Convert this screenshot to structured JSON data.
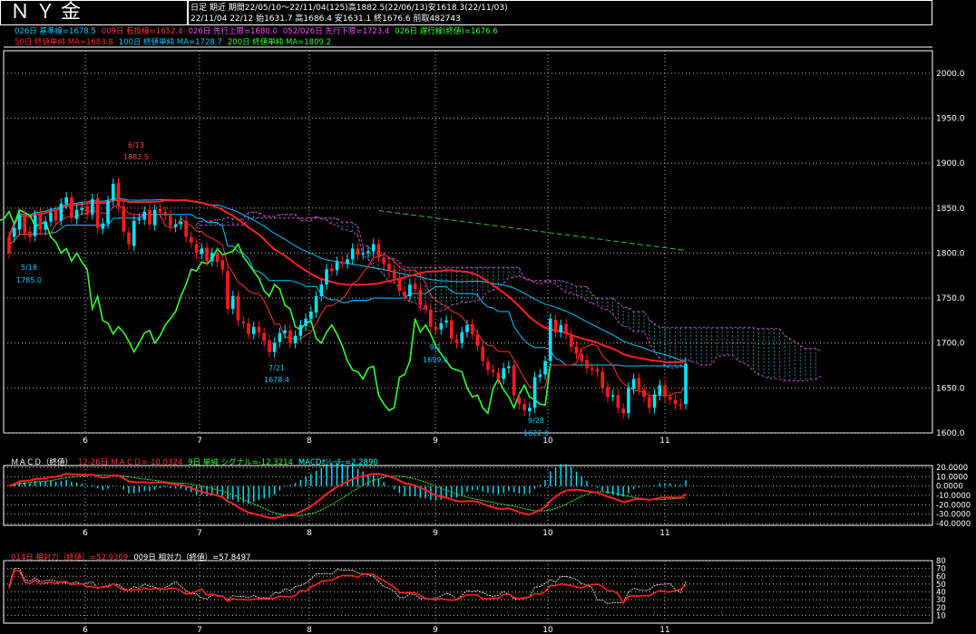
{
  "header": {
    "title": "ＮＹ金",
    "line1": "日足 期近 期間22/05/10～22/11/04(125)高1882.5(22/06/13)安1618.3(22/11/03)",
    "line2": "22/11/04 22/12 始1631.7 高1686.4 安1631.1 終1676.6 前取482743"
  },
  "legend": {
    "row1": [
      {
        "text": "026日 基準線=1678.5",
        "color": "#00c8ff"
      },
      {
        "text": "009日 転換線=1652.4",
        "color": "#ff3030"
      },
      {
        "text": "026日 先行上限=1680.0",
        "color": "#ff44ff"
      },
      {
        "text": "052/026日 先行下限=1723.4",
        "color": "#ff44ff"
      },
      {
        "text": "026日 遅行線(終値)=1676.6",
        "color": "#30ff30"
      }
    ],
    "row2": [
      {
        "text": "50日 終値単純 MA=1683.8",
        "color": "#ff2020"
      },
      {
        "text": "100日 終値単純 MA=1728.7",
        "color": "#00c8ff"
      },
      {
        "text": "200日 終値単純 MA=1809.2",
        "color": "#30ff30"
      }
    ],
    "macd": [
      {
        "text": "ＭＡＣＤ（終値）",
        "color": "#ffffff"
      },
      {
        "text": "12-26日 ＭＡＣＤ=-10.0324",
        "color": "#ff3030"
      },
      {
        "text": "9日 単純 シグナル=-12.3214",
        "color": "#30ff30"
      },
      {
        "text": "MACDｵｼﾚｰﾀｰ=2.2890",
        "color": "#00ffff"
      }
    ],
    "rsi": [
      {
        "text": "014日 相対力（終値）=52.9369",
        "color": "#ff3030"
      },
      {
        "text": "009日 相対力（終値）=57.8497",
        "color": "#ffffff"
      }
    ]
  },
  "colors": {
    "up": "#00e5ff",
    "down": "#ff1a1a",
    "ma50": "#ff2020",
    "ma100": "#00c8ff",
    "ma200": "#30c030",
    "chikou": "#30ff30",
    "cloud": "#cc44cc",
    "grid": "#bdbdbd"
  },
  "chart_data": [
    {
      "type": "candlestick",
      "title": "ＮＹ金",
      "x_ticks": [
        "6",
        "7",
        "8",
        "9",
        "10",
        "11"
      ],
      "ylim": [
        1600,
        2025
      ],
      "y_ticks": [
        "2000.0",
        "1950.0",
        "1900.0",
        "1850.0",
        "1800.0",
        "1750.0",
        "1700.0",
        "1650.0",
        "1600.0"
      ],
      "annotations": [
        {
          "date": "5/18",
          "value": "1785.0"
        },
        {
          "date": "6/13",
          "value": "1882.5"
        },
        {
          "date": "7/21",
          "value": "1678.4"
        },
        {
          "date": "9/1",
          "value": "1699.0"
        },
        {
          "date": "9/28",
          "value": "1622.0"
        }
      ],
      "close": [
        1800,
        1828,
        1842,
        1822,
        1818,
        1842,
        1826,
        1835,
        1845,
        1836,
        1855,
        1862,
        1840,
        1848,
        1850,
        1843,
        1860,
        1828,
        1833,
        1858,
        1877,
        1852,
        1824,
        1810,
        1836,
        1838,
        1846,
        1832,
        1848,
        1845,
        1842,
        1830,
        1832,
        1835,
        1818,
        1812,
        1800,
        1805,
        1791,
        1800,
        1790,
        1782,
        1738,
        1752,
        1725,
        1722,
        1710,
        1718,
        1712,
        1702,
        1690,
        1700,
        1711,
        1714,
        1700,
        1708,
        1720,
        1727,
        1735,
        1752,
        1765,
        1782,
        1780,
        1790,
        1788,
        1793,
        1805,
        1798,
        1800,
        1802,
        1810,
        1796,
        1788,
        1780,
        1772,
        1758,
        1752,
        1765,
        1760,
        1742,
        1738,
        1718,
        1715,
        1722,
        1725,
        1705,
        1700,
        1712,
        1720,
        1710,
        1697,
        1680,
        1670,
        1668,
        1660,
        1672,
        1674,
        1642,
        1632,
        1625,
        1628,
        1662,
        1665,
        1680,
        1727,
        1712,
        1720,
        1710,
        1696,
        1688,
        1680,
        1672,
        1670,
        1668,
        1650,
        1640,
        1642,
        1628,
        1622,
        1650,
        1660,
        1648,
        1640,
        1628,
        1643,
        1653,
        1640,
        1637,
        1632,
        1631,
        1677
      ],
      "open": [
        1818,
        1818,
        1826,
        1842,
        1824,
        1819,
        1843,
        1826,
        1835,
        1846,
        1836,
        1855,
        1862,
        1838,
        1848,
        1852,
        1843,
        1861,
        1827,
        1833,
        1859,
        1878,
        1852,
        1823,
        1808,
        1838,
        1837,
        1848,
        1831,
        1849,
        1846,
        1842,
        1829,
        1832,
        1836,
        1818,
        1810,
        1799,
        1806,
        1791,
        1800,
        1792,
        1780,
        1738,
        1752,
        1724,
        1722,
        1710,
        1718,
        1711,
        1703,
        1690,
        1701,
        1711,
        1714,
        1700,
        1708,
        1719,
        1727,
        1734,
        1752,
        1765,
        1783,
        1781,
        1790,
        1788,
        1793,
        1805,
        1799,
        1800,
        1802,
        1810,
        1795,
        1788,
        1781,
        1772,
        1757,
        1752,
        1766,
        1759,
        1742,
        1737,
        1718,
        1715,
        1723,
        1725,
        1704,
        1700,
        1712,
        1721,
        1710,
        1696,
        1679,
        1670,
        1667,
        1660,
        1672,
        1675,
        1640,
        1632,
        1624,
        1628,
        1662,
        1665,
        1680,
        1726,
        1712,
        1721,
        1710,
        1696,
        1688,
        1681,
        1672,
        1671,
        1668,
        1651,
        1641,
        1642,
        1627,
        1622,
        1649,
        1661,
        1648,
        1640,
        1628,
        1642,
        1653,
        1640,
        1637,
        1632,
        1632
      ]
    },
    {
      "type": "bar+line",
      "title": "ＭＡＣＤ（終値）",
      "y_ticks": [
        "20.0000",
        "10.0000",
        "0.0000",
        "-10.0000",
        "-20.0000",
        "-30.0000",
        "-40.0000"
      ],
      "ylim": [
        -42,
        22
      ]
    },
    {
      "type": "line",
      "title": "相対力",
      "y_ticks": [
        "80",
        "70",
        "60",
        "50",
        "40",
        "30",
        "20",
        "10"
      ],
      "ylim": [
        0,
        80
      ]
    }
  ]
}
